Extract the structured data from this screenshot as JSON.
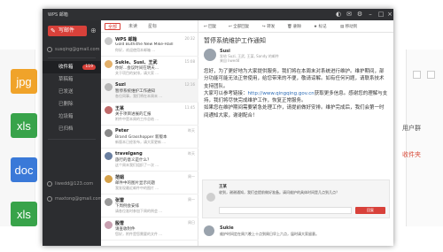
{
  "app": {
    "title": "WPS 邮箱"
  },
  "background": {
    "file_tiles": [
      {
        "label": "jpg",
        "color": "#f0a32a"
      },
      {
        "label": "xls",
        "color": "#38a34a"
      },
      {
        "label": "doc",
        "color": "#3a79d8"
      },
      {
        "label": "xls",
        "color": "#38a34a"
      }
    ],
    "right_text_1": "用户群",
    "right_text_2": "收件夹"
  },
  "nav": {
    "compose_label": "写邮件",
    "accounts": [
      {
        "label": "susqing@gmail.com"
      },
      {
        "label": "liwedd@123.com"
      },
      {
        "label": "maxtong@gmail.com"
      }
    ],
    "items": [
      {
        "label": "收件箱",
        "badge": "119",
        "selected": true
      },
      {
        "label": "草稿箱",
        "badge": ""
      },
      {
        "label": "已发送",
        "badge": ""
      },
      {
        "label": "已删除",
        "badge": ""
      },
      {
        "label": "垃圾箱",
        "badge": ""
      },
      {
        "label": "已归档",
        "badge": ""
      }
    ]
  },
  "list": {
    "tabs": [
      "全部",
      "未读",
      "星标"
    ],
    "messages": [
      {
        "sender": "WPS 邮箱",
        "time": "20:32",
        "subject": "Gold Buthithe New Mike-Haill",
        "preview": "你好，欢迎使用本邮箱 ...",
        "avatar": "#c9c9c9"
      },
      {
        "sender": "Sukie、Susi、王武",
        "time": "15:08",
        "subject": "你好...会议时间在明天...",
        "preview": "关于项目的安排，请大家 ...",
        "avatar": "#e3b06a"
      },
      {
        "sender": "Suzi",
        "time": "12:16",
        "subject": "暂停系统维护工作通知",
        "preview": "各位同事，我们将在本周末 ...",
        "avatar": "#b7b7b7"
      },
      {
        "sender": "王某",
        "time": "11:45",
        "subject": "关于项目进展的汇报",
        "preview": "附件中是本周的工作总结 ...",
        "avatar": "#c06a6a"
      },
      {
        "sender": "Peter",
        "time": "昨天",
        "subject": "Brand Grasshopper 新版本",
        "preview": "新版本已经发布，请大家更新 ...",
        "avatar": "#8a8a8a"
      },
      {
        "sender": "travelgang",
        "time": "昨天",
        "subject": "旅行的意义是什么？",
        "preview": "这个周末我们组织了一次 ...",
        "avatar": "#6a7fa0"
      },
      {
        "sender": "范娟",
        "time": "周一",
        "subject": "邮件中的图片显示问题",
        "preview": "我发现最近邮件中的图片 ...",
        "avatar": "#d6a24a"
      },
      {
        "sender": "张雷",
        "time": "周一",
        "subject": "下周例会安排",
        "preview": "请各位准时参加下周的例会 ...",
        "avatar": "#9a9a9a"
      },
      {
        "sender": "殷雪",
        "time": "周日",
        "subject": "请查收附件",
        "preview": "您好，附件是您需要的文件 ...",
        "avatar": "#c8a0b0"
      }
    ]
  },
  "toolbar": {
    "reply": "回复",
    "reply_all": "全部回复",
    "forward": "转发",
    "delete": "删除",
    "mark": "标记",
    "move": "移动到"
  },
  "reading": {
    "subject": "暂停系统维护工作通知",
    "sender": "Susi",
    "to": "发给 Suzi, 王武, 王某, Sandy 的邮件",
    "from": "来自 liwedd",
    "body_1": "您好，为了更好地为大家提供服务，我们将在本周末对系统进行维护。维护期间，部分功能可能无法正常使用，给您带来的不便，敬请谅解。如有任何问题，请联系技术支持团队。",
    "body_2a": "大家可以参考链接：",
    "body_link": "http://www.qingqing.gov.cn",
    "body_2b": "获取更多信息。感谢您的理解与支持，我们将尽快完成维护工作，恢复正常服务。",
    "body_3": "如果您在维护期间需要紧急处理工作，请提前做好安排。维护完成后，我们会第一时间通知大家，谢谢配合！",
    "comment": {
      "name": "王某",
      "text": "收到，谢谢通知，我们会提前做好准备。请问维护的具体时间是几点到几点？",
      "button": "回复"
    },
    "reply": {
      "name": "Sukie",
      "text": "维护时间定在周六晚上十点到周日早上六点，届时请大家留意。"
    }
  }
}
